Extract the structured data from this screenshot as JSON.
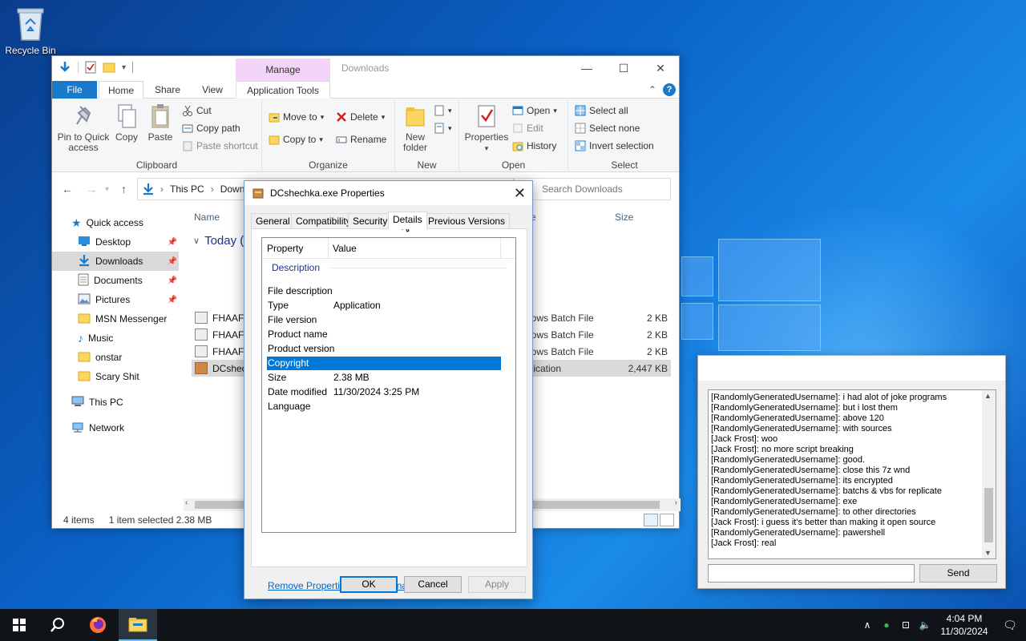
{
  "desktop": {
    "recycle_bin_label": "Recycle Bin"
  },
  "explorer": {
    "title": "Downloads",
    "contextual_tab": "Manage",
    "tabs": [
      "File",
      "Home",
      "Share",
      "View",
      "Application Tools"
    ],
    "ribbon": {
      "clipboard": {
        "label": "Clipboard",
        "pin": "Pin to Quick access",
        "copy": "Copy",
        "paste": "Paste",
        "cut": "Cut",
        "copy_path": "Copy path",
        "paste_shortcut": "Paste shortcut"
      },
      "organize": {
        "label": "Organize",
        "move_to": "Move to",
        "copy_to": "Copy to",
        "delete": "Delete",
        "rename": "Rename"
      },
      "new": {
        "label": "New",
        "new_folder": "New folder"
      },
      "open": {
        "label": "Open",
        "properties": "Properties",
        "open": "Open",
        "edit": "Edit",
        "history": "History"
      },
      "select": {
        "label": "Select",
        "select_all": "Select all",
        "select_none": "Select none",
        "invert": "Invert selection"
      }
    },
    "address": {
      "this_pc": "This PC",
      "current": "Down",
      "search_placeholder": "Search Downloads"
    },
    "nav": {
      "quick_access": "Quick access",
      "items": [
        "Desktop",
        "Downloads",
        "Documents",
        "Pictures",
        "MSN Messenger",
        "Music",
        "onstar",
        "Scary Shit"
      ],
      "this_pc": "This PC",
      "network": "Network"
    },
    "columns": {
      "name": "Name",
      "type": "e",
      "size": "Size"
    },
    "group_header": "Today (4",
    "files": [
      {
        "name": "FHAAFS",
        "type": "dows Batch File",
        "size": "2 KB"
      },
      {
        "name": "FHAAFS",
        "type": "dows Batch File",
        "size": "2 KB"
      },
      {
        "name": "FHAAFS",
        "type": "dows Batch File",
        "size": "2 KB"
      },
      {
        "name": "DCshec",
        "type": "plication",
        "size": "2,447 KB"
      }
    ],
    "status": {
      "items": "4 items",
      "selected": "1 item selected  2.38 MB"
    }
  },
  "properties": {
    "title": "DCshechka.exe Properties",
    "tabs": [
      "General",
      "Compatibility",
      "Security",
      "Details",
      "Previous Versions"
    ],
    "col_property": "Property",
    "col_value": "Value",
    "section": "Description",
    "rows": [
      {
        "k": "File description",
        "v": ""
      },
      {
        "k": "Type",
        "v": "Application"
      },
      {
        "k": "File version",
        "v": ""
      },
      {
        "k": "Product name",
        "v": ""
      },
      {
        "k": "Product version",
        "v": ""
      },
      {
        "k": "Copyright",
        "v": ""
      },
      {
        "k": "Size",
        "v": "2.38 MB"
      },
      {
        "k": "Date modified",
        "v": "11/30/2024 3:25 PM"
      },
      {
        "k": "Language",
        "v": ""
      }
    ],
    "remove_link": "Remove Properties and Personal Information",
    "ok": "OK",
    "cancel": "Cancel",
    "apply": "Apply"
  },
  "chat": {
    "messages": [
      "[RandomlyGeneratedUsername]: i had alot of joke programs",
      "[RandomlyGeneratedUsername]: but i lost them",
      "[RandomlyGeneratedUsername]: above 120",
      "[RandomlyGeneratedUsername]: with sources",
      "[Jack Frost]: woo",
      "[Jack Frost]: no more script breaking",
      "[RandomlyGeneratedUsername]: good.",
      "[RandomlyGeneratedUsername]: close this 7z wnd",
      "[RandomlyGeneratedUsername]: its encrypted",
      "[RandomlyGeneratedUsername]: batchs & vbs for replicate",
      "[RandomlyGeneratedUsername]: exe",
      "[RandomlyGeneratedUsername]: to other directories",
      "[Jack Frost]: i guess it's better than making it open source",
      "[RandomlyGeneratedUsername]: pawershell",
      "[Jack Frost]: real"
    ],
    "send": "Send",
    "input_value": ""
  },
  "taskbar": {
    "time": "4:04 PM",
    "date": "11/30/2024"
  },
  "colors": {
    "accent": "#0078d7",
    "file_tab": "#1979ca",
    "manage_tab": "#f2d4f8"
  }
}
